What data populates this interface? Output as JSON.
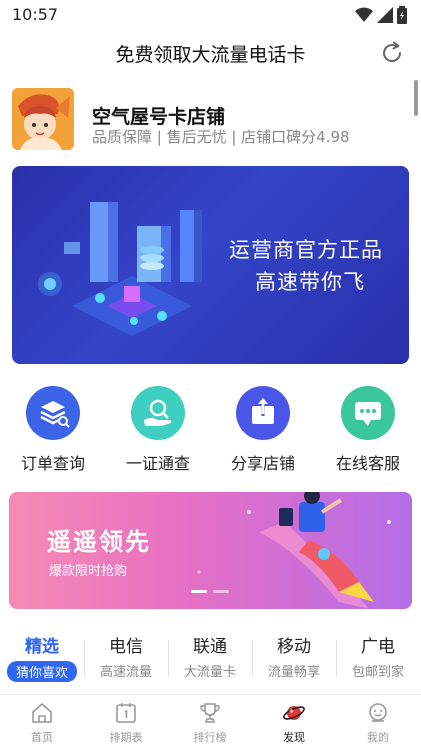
{
  "status_bar": {
    "time": "10:57"
  },
  "header": {
    "title": "免费领取大流量电话卡"
  },
  "shop": {
    "name": "空气屋号卡店铺",
    "description": "品质保障 | 售后无忧 | 店铺口碑分4.98"
  },
  "hero_banner": {
    "line1": "运营商官方正品",
    "line2": "高速带你飞"
  },
  "quick_actions": [
    {
      "label": "订单查询",
      "icon": "order-search-icon",
      "color": "#3d63e6"
    },
    {
      "label": "一证通查",
      "icon": "id-search-icon",
      "color": "#3fcfc0"
    },
    {
      "label": "分享店铺",
      "icon": "share-icon",
      "color": "#4a56e8"
    },
    {
      "label": "在线客服",
      "icon": "chat-icon",
      "color": "#3ac79a"
    }
  ],
  "promo_banner": {
    "title": "遥遥领先",
    "subtitle": "爆款限时抢购"
  },
  "categories": [
    {
      "name": "精选",
      "sub": "猜你喜欢",
      "active": true
    },
    {
      "name": "电信",
      "sub": "高速流量",
      "active": false
    },
    {
      "name": "联通",
      "sub": "大流量卡",
      "active": false
    },
    {
      "name": "移动",
      "sub": "流量畅享",
      "active": false
    },
    {
      "name": "广电",
      "sub": "包邮到家",
      "active": false
    }
  ],
  "bottom_nav": [
    {
      "label": "首页",
      "icon": "home-icon",
      "active": false
    },
    {
      "label": "排期表",
      "icon": "calendar-icon",
      "active": false
    },
    {
      "label": "排行榜",
      "icon": "trophy-icon",
      "active": false
    },
    {
      "label": "发现",
      "icon": "planet-icon",
      "active": true
    },
    {
      "label": "我的",
      "icon": "profile-icon",
      "active": false
    }
  ],
  "colors": {
    "accent": "#2f66f2",
    "hero_bg": "#2f3bb8",
    "nav_active": "#e53935"
  }
}
